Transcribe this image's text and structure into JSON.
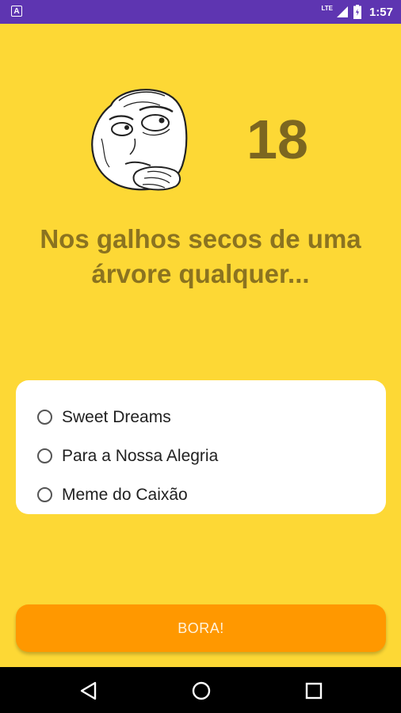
{
  "status_bar": {
    "app_icon": "A",
    "network": "LTE",
    "time": "1:57",
    "icons": [
      "signal-icon",
      "battery-icon"
    ]
  },
  "quiz": {
    "number": "18",
    "question": "Nos galhos secos de uma árvore qualquer...",
    "options": [
      "Sweet Dreams",
      "Para a Nossa Alegria",
      "Meme do Caixão"
    ],
    "submit_label": "BORA!"
  },
  "colors": {
    "background": "#FDD835",
    "status_bar": "#5E35B1",
    "question_text": "#8B7320",
    "button": "#FF9800"
  },
  "nav_bar": {
    "icons": [
      "back-icon",
      "home-icon",
      "recent-apps-icon"
    ]
  }
}
